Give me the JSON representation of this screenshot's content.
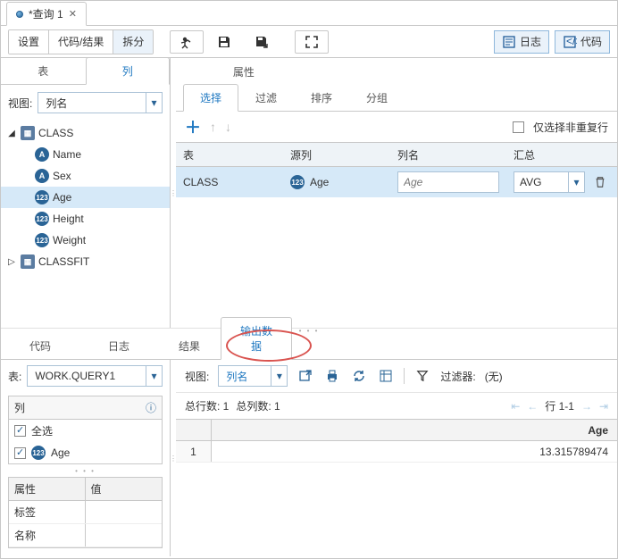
{
  "fileTab": {
    "title": "*查询 1"
  },
  "toolbar": {
    "settings": "设置",
    "codeResults": "代码/结果",
    "split": "拆分",
    "log": "日志",
    "code": "代码"
  },
  "leftTabs": {
    "table": "表",
    "column": "列",
    "attr": "属性"
  },
  "view": {
    "label": "视图:",
    "value": "列名"
  },
  "tree": {
    "class": "CLASS",
    "cols": [
      "Name",
      "Sex",
      "Age",
      "Height",
      "Weight"
    ],
    "classfit": "CLASSFIT"
  },
  "subTabs": {
    "select": "选择",
    "filter": "过滤",
    "sort": "排序",
    "group": "分组"
  },
  "distinct": "仅选择非重复行",
  "gridHead": {
    "table": "表",
    "src": "源列",
    "name": "列名",
    "agg": "汇总"
  },
  "gridRow": {
    "table": "CLASS",
    "src": "Age",
    "namePlaceholder": "Age",
    "agg": "AVG"
  },
  "bottomTabs": {
    "code": "代码",
    "log": "日志",
    "result": "结果",
    "output": "输出数据"
  },
  "tableSel": {
    "label": "表:",
    "value": "WORK.QUERY1"
  },
  "colsPanel": {
    "title": "列",
    "all": "全选",
    "age": "Age"
  },
  "propGrid": {
    "attr": "属性",
    "val": "值",
    "label": "标签",
    "name": "名称"
  },
  "brView": {
    "label": "视图:",
    "value": "列名"
  },
  "filter": {
    "label": "过滤器:",
    "value": "(无)"
  },
  "pager": {
    "rows": "总行数: 1",
    "cols": "总列数: 1",
    "range": "行 1-1"
  },
  "dataGrid": {
    "head": "Age",
    "rownum": "1",
    "val": "13.315789474"
  }
}
